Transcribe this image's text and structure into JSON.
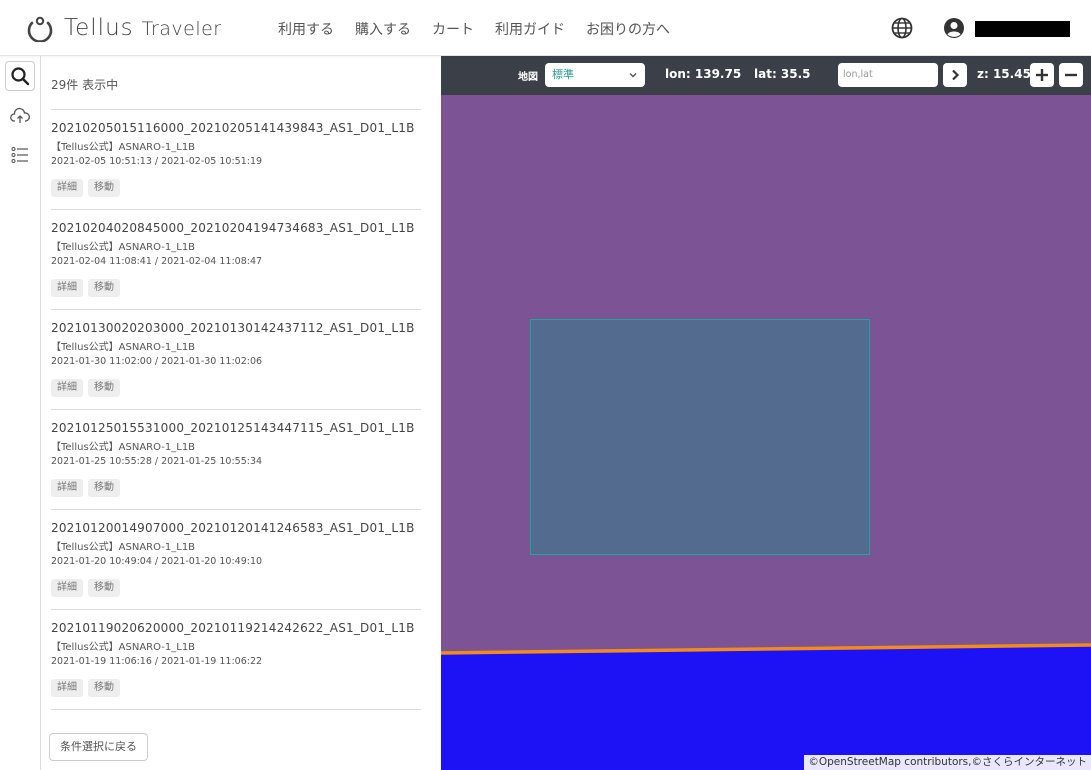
{
  "header": {
    "brand_main": "Tellus",
    "brand_sub": "Traveler",
    "nav": [
      "利用する",
      "購入する",
      "カート",
      "利用ガイド",
      "お困りの方へ"
    ]
  },
  "panel": {
    "count_label": "29件 表示中",
    "items": [
      {
        "title": "20210205015116000_20210205141439843_AS1_D01_L1B",
        "source": "【Tellus公式】ASNARO-1_L1B",
        "dates": "2021-02-05 10:51:13 / 2021-02-05 10:51:19"
      },
      {
        "title": "20210204020845000_20210204194734683_AS1_D01_L1B",
        "source": "【Tellus公式】ASNARO-1_L1B",
        "dates": "2021-02-04 11:08:41 / 2021-02-04 11:08:47"
      },
      {
        "title": "20210130020203000_20210130142437112_AS1_D01_L1B",
        "source": "【Tellus公式】ASNARO-1_L1B",
        "dates": "2021-01-30 11:02:00 / 2021-01-30 11:02:06"
      },
      {
        "title": "20210125015531000_20210125143447115_AS1_D01_L1B",
        "source": "【Tellus公式】ASNARO-1_L1B",
        "dates": "2021-01-25 10:55:28 / 2021-01-25 10:55:34"
      },
      {
        "title": "20210120014907000_20210120141246583_AS1_D01_L1B",
        "source": "【Tellus公式】ASNARO-1_L1B",
        "dates": "2021-01-20 10:49:04 / 2021-01-20 10:49:10"
      },
      {
        "title": "20210119020620000_20210119214242622_AS1_D01_L1B",
        "source": "【Tellus公式】ASNARO-1_L1B",
        "dates": "2021-01-19 11:06:16 / 2021-01-19 11:06:22"
      }
    ],
    "detail_label": "詳細",
    "move_label": "移動",
    "back_label": "条件選択に戻る"
  },
  "map": {
    "map_label": "地図",
    "layer_selected": "標準",
    "lon_text": "lon: 139.75",
    "lat_text": "lat: 35.5",
    "coord_placeholder": "lon,lat",
    "zoom_text": "z: 15.45",
    "attribution": "©OpenStreetMap contributors,©さくらインターネット",
    "colors": {
      "land": "#7c5496",
      "water": "#1c12f5",
      "coast": "#f28a1c",
      "footprint_fill": "#536b8e",
      "footprint_border": "#17a89b"
    }
  },
  "icons": {
    "rail": [
      "search-icon",
      "cloud-upload-icon",
      "list-icon"
    ],
    "header": [
      "globe-icon",
      "user-icon"
    ]
  }
}
